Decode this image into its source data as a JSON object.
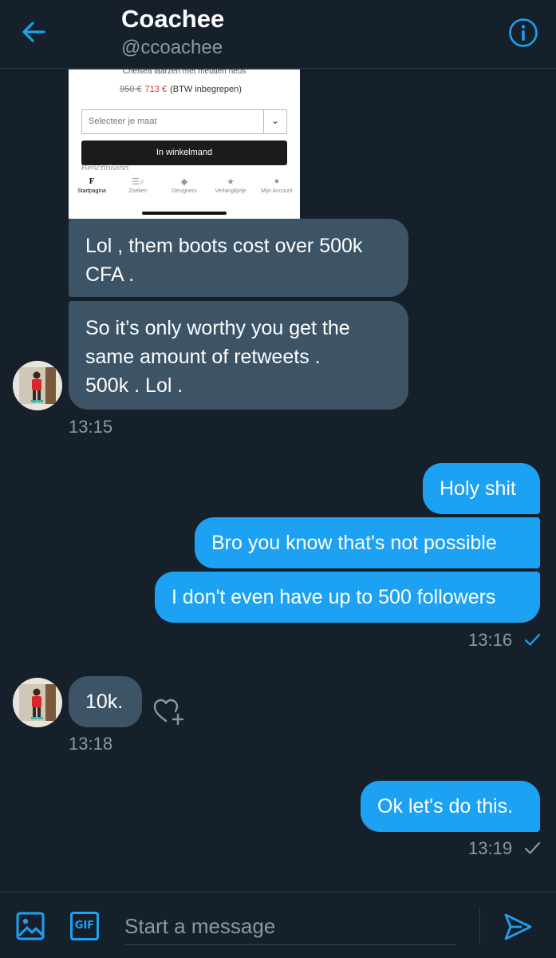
{
  "header": {
    "title": "Coachee",
    "handle": "@ccoachee",
    "colors": {
      "accent": "#1da1f2",
      "background": "#15202b"
    }
  },
  "shared_image": {
    "caption": "Chelsea laarzen met metalen neus",
    "price_old": "950 €",
    "price_new": "713 €",
    "price_note": "(BTW inbegrepen)",
    "select_placeholder": "Selecteer je maat",
    "cart_button": "In winkelmand",
    "description_label": "Beschrijving",
    "tabs": [
      {
        "label": "Startpagina",
        "icon": "F"
      },
      {
        "label": "Zoeken",
        "icon": "☰⌕"
      },
      {
        "label": "Designers",
        "icon": "◆"
      },
      {
        "label": "Verlanglijstje",
        "icon": "★"
      },
      {
        "label": "Mijn Account",
        "icon": "●"
      }
    ]
  },
  "messages": [
    {
      "text_lines": [
        "Lol , them boots cost over 500k",
        "CFA ."
      ],
      "direction": "incoming"
    },
    {
      "text_lines": [
        "So it’s only worthy you get the",
        "same amount of retweets .",
        "500k . Lol ."
      ],
      "direction": "incoming"
    },
    {
      "text": "Holy shit",
      "direction": "outgoing"
    },
    {
      "text": "Bro you know that's not possible",
      "direction": "outgoing"
    },
    {
      "text": "I don't even have up to 500 followers",
      "direction": "outgoing"
    },
    {
      "text": "10k.",
      "direction": "incoming"
    },
    {
      "text": "Ok let's do this.",
      "direction": "outgoing"
    }
  ],
  "timestamps": {
    "incoming_1": "13:15",
    "outgoing_1": "13:16",
    "incoming_2": "13:18",
    "outgoing_2": "13:19"
  },
  "read_status": {
    "outgoing_1": {
      "icon": "check-icon",
      "color": "#1da1f2"
    },
    "outgoing_2": {
      "icon": "check-icon",
      "color": "#8899a6"
    }
  },
  "composer": {
    "placeholder": "Start a message",
    "gif_label": "GIF"
  }
}
